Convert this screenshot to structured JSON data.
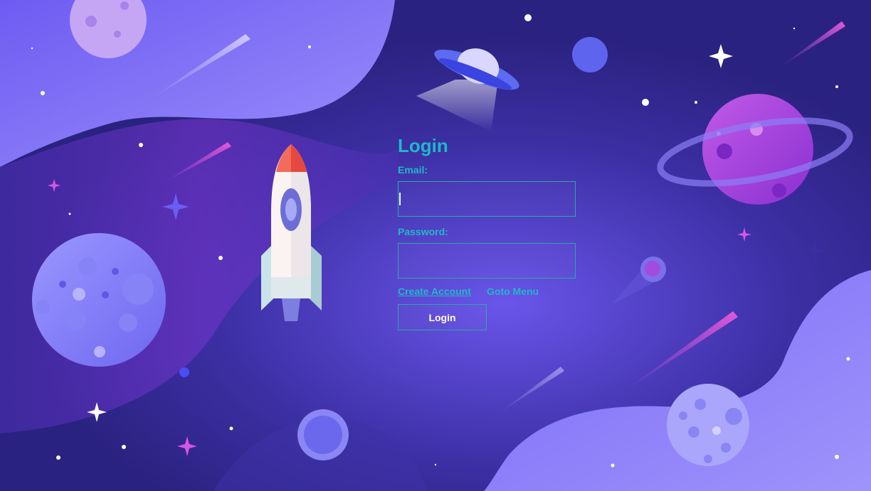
{
  "login": {
    "title": "Login",
    "email_label": "Email:",
    "email_value": "",
    "password_label": "Password:",
    "password_value": "",
    "create_account_link": "Create Account",
    "goto_menu_link": "Goto Menu",
    "submit_label": "Login"
  },
  "theme": {
    "background": "#2c2482",
    "wave_light": "#8b7cf6",
    "accent_teal": "#1fb8c8",
    "input_border": "#2aa9a4"
  },
  "illustration": {
    "icons": [
      "rocket-icon",
      "ufo-icon",
      "ringed-planet-icon",
      "cratered-planet-icon",
      "comet-icon",
      "star-icon"
    ]
  }
}
